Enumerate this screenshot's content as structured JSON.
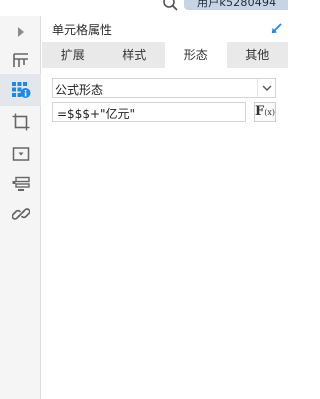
{
  "topbar": {
    "user_label": "用户k5280494",
    "search_icon": "search-icon"
  },
  "leftbar": {
    "items": [
      {
        "name": "expand-arrow-icon"
      },
      {
        "name": "template-layout-icon"
      },
      {
        "name": "cell-properties-icon",
        "active": true
      },
      {
        "name": "cell-element-icon"
      },
      {
        "name": "widget-icon"
      },
      {
        "name": "parameter-icon"
      },
      {
        "name": "hyperlink-icon"
      }
    ]
  },
  "panel": {
    "title": "单元格属性",
    "collapse_icon": "collapse-arrow-icon",
    "tabs": [
      {
        "label": "扩展"
      },
      {
        "label": "样式"
      },
      {
        "label": "形态",
        "active": true
      },
      {
        "label": "其他"
      }
    ],
    "form_type": "公式形态",
    "formula": "=$$$+\"亿元\"",
    "fx_label": "F",
    "fx_sub": "(x)"
  },
  "colors": {
    "accent": "#1e88e5",
    "active_tab": "#ffffff",
    "tab_bar": "#e9e9e9",
    "sidebar": "#f5f5f5"
  }
}
